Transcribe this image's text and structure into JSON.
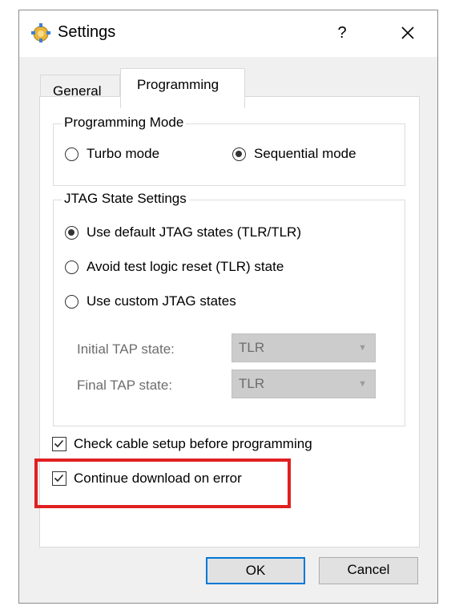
{
  "window": {
    "title": "Settings",
    "help_label": "?",
    "close_label": "✕",
    "icon": "settings-gear-icon"
  },
  "tabs": [
    {
      "label": "General",
      "active": false
    },
    {
      "label": "Programming",
      "active": true
    }
  ],
  "programming_mode": {
    "legend": "Programming Mode",
    "options": [
      {
        "label": "Turbo mode",
        "checked": false
      },
      {
        "label": "Sequential mode",
        "checked": true
      }
    ]
  },
  "jtag": {
    "legend": "JTAG State Settings",
    "options": [
      {
        "label": "Use default JTAG states (TLR/TLR)",
        "checked": true
      },
      {
        "label": "Avoid test logic reset (TLR) state",
        "checked": false
      },
      {
        "label": "Use custom JTAG states",
        "checked": false
      }
    ],
    "initial_label": "Initial TAP state:",
    "initial_value": "TLR",
    "final_label": "Final TAP state:",
    "final_value": "TLR"
  },
  "checkboxes": [
    {
      "label": "Check cable setup before programming",
      "checked": true
    },
    {
      "label": "Continue download on error",
      "checked": true
    }
  ],
  "buttons": {
    "ok": "OK",
    "cancel": "Cancel"
  },
  "colors": {
    "accent": "#0078d7",
    "highlight": "#e02020"
  }
}
